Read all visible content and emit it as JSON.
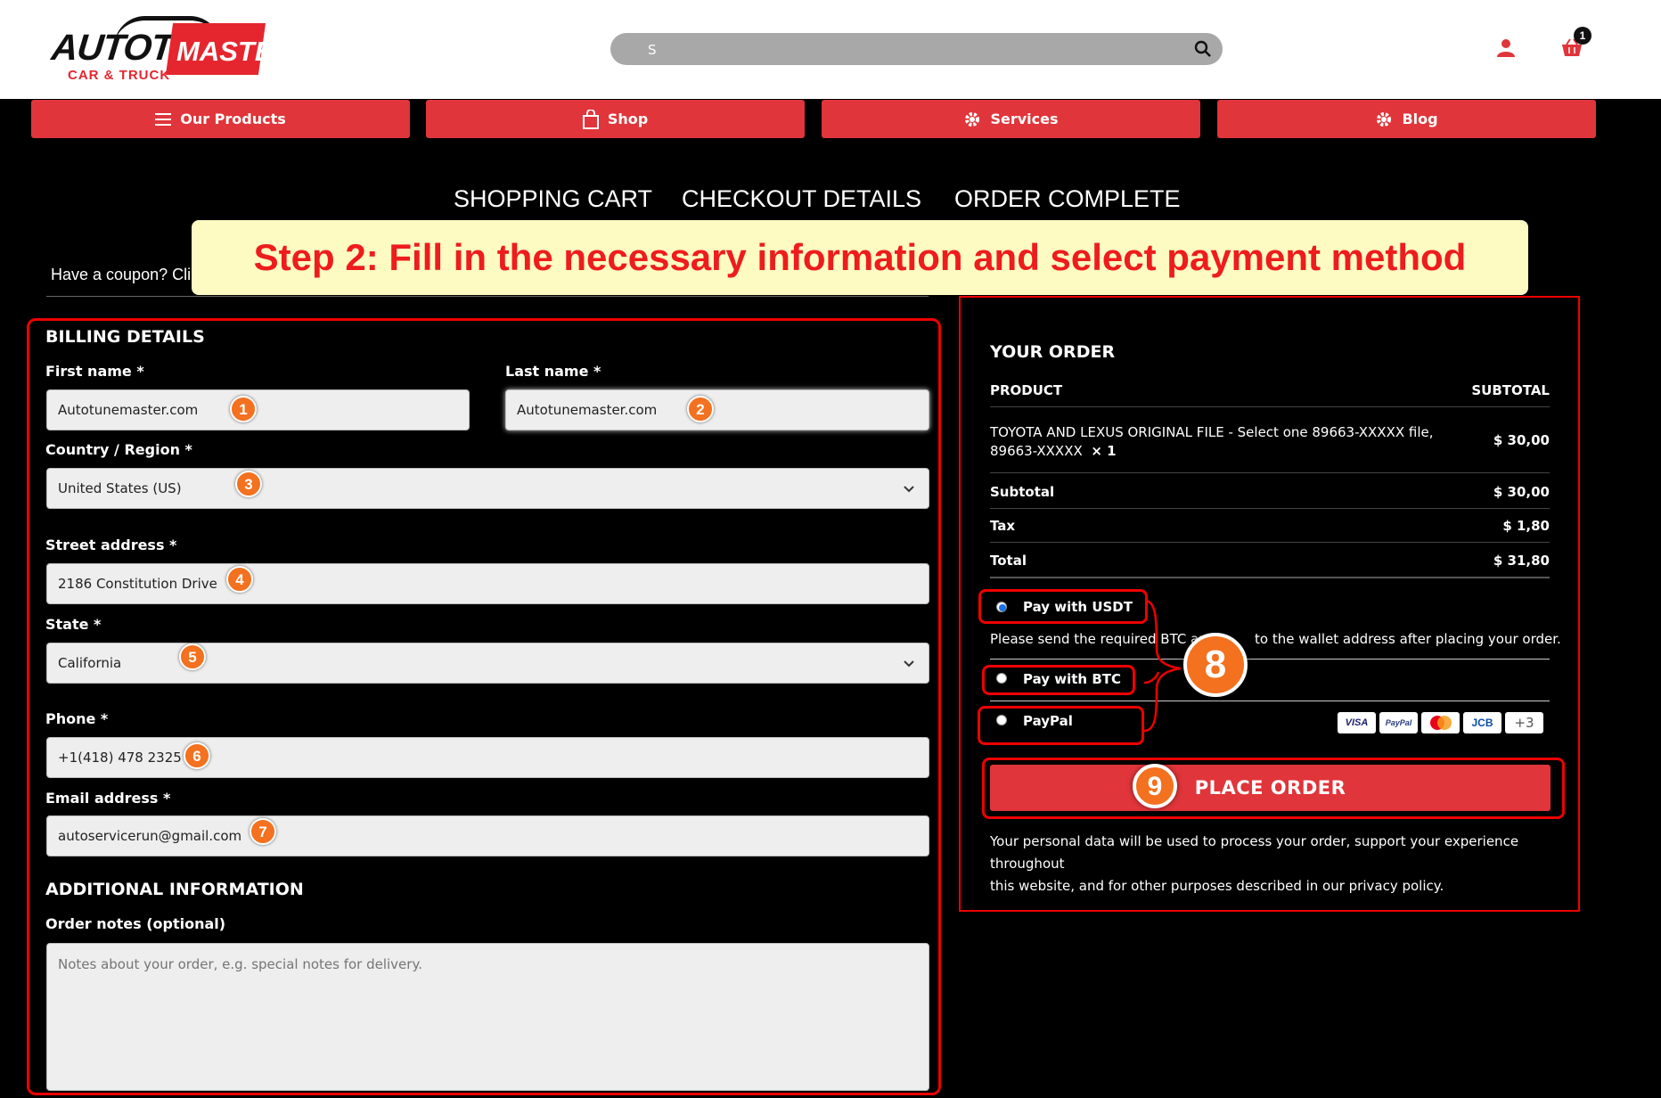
{
  "header": {
    "logo": {
      "word": "AUTOTUNE",
      "master": "MASTER",
      "sub": "CAR & TRUCK"
    },
    "search": {
      "value": "S"
    },
    "cart_count": "1"
  },
  "nav": [
    {
      "label": "Our Products",
      "icon": "menu-icon"
    },
    {
      "label": "Shop",
      "icon": "bag-icon"
    },
    {
      "label": "Services",
      "icon": "gear-wrench-icon"
    },
    {
      "label": "Blog",
      "icon": "gear-wrench-icon"
    }
  ],
  "steps": [
    "SHOPPING CART",
    "CHECKOUT DETAILS",
    "ORDER COMPLETE"
  ],
  "banner": "Step 2:  Fill in the necessary information and select payment method",
  "coupon": "Have a coupon? Cli",
  "billing": {
    "title": "BILLING DETAILS",
    "first_name": {
      "label": "First name *",
      "value": "Autotunemaster.com"
    },
    "last_name": {
      "label": "Last name *",
      "value": "Autotunemaster.com"
    },
    "country": {
      "label": "Country / Region *",
      "value": "United States (US)"
    },
    "street": {
      "label": "Street address *",
      "value": "2186 Constitution Drive"
    },
    "state": {
      "label": "State *",
      "value": "California"
    },
    "phone": {
      "label": "Phone *",
      "value": "+1(418) 478 2325"
    },
    "email": {
      "label": "Email address *",
      "value": "autoservicerun@gmail.com"
    },
    "additional_title": "ADDITIONAL INFORMATION",
    "notes": {
      "label": "Order notes (optional)",
      "placeholder": "Notes about your order, e.g. special notes for delivery."
    }
  },
  "badges": [
    "1",
    "2",
    "3",
    "4",
    "5",
    "6",
    "7",
    "8",
    "9"
  ],
  "order": {
    "title": "YOUR ORDER",
    "col_product": "PRODUCT",
    "col_subtotal": "SUBTOTAL",
    "item_line1": "TOYOTA AND LEXUS ORIGINAL FILE - Select one 89663-XXXXX file,",
    "item_line2": "89663-XXXXX",
    "item_qty": "× 1",
    "item_price": "$ 30,00",
    "rows": [
      {
        "label": "Subtotal",
        "value": "$ 30,00"
      },
      {
        "label": "Tax",
        "value": "$ 1,80"
      },
      {
        "label": "Total",
        "value": "$ 31,80"
      }
    ],
    "payments": {
      "usdt": "Pay with USDT",
      "usdt_note_a": "Please send the required BTC am",
      "usdt_note_b": "to the wallet address after placing your order.",
      "btc": "Pay with BTC",
      "paypal": "PayPal"
    },
    "cards": [
      "VISA",
      "PayPal",
      "Mastercard",
      "JCB",
      "+3"
    ],
    "place_order": "PLACE ORDER",
    "privacy_a": "Your personal data will be used to process your order, support your experience throughout",
    "privacy_b": "this website, and for other purposes described in our privacy policy."
  },
  "colors": {
    "accent": "#e0353a",
    "badge": "#f3711f",
    "banner_bg": "#fdfbc2",
    "banner_text": "#ee1c1c"
  }
}
